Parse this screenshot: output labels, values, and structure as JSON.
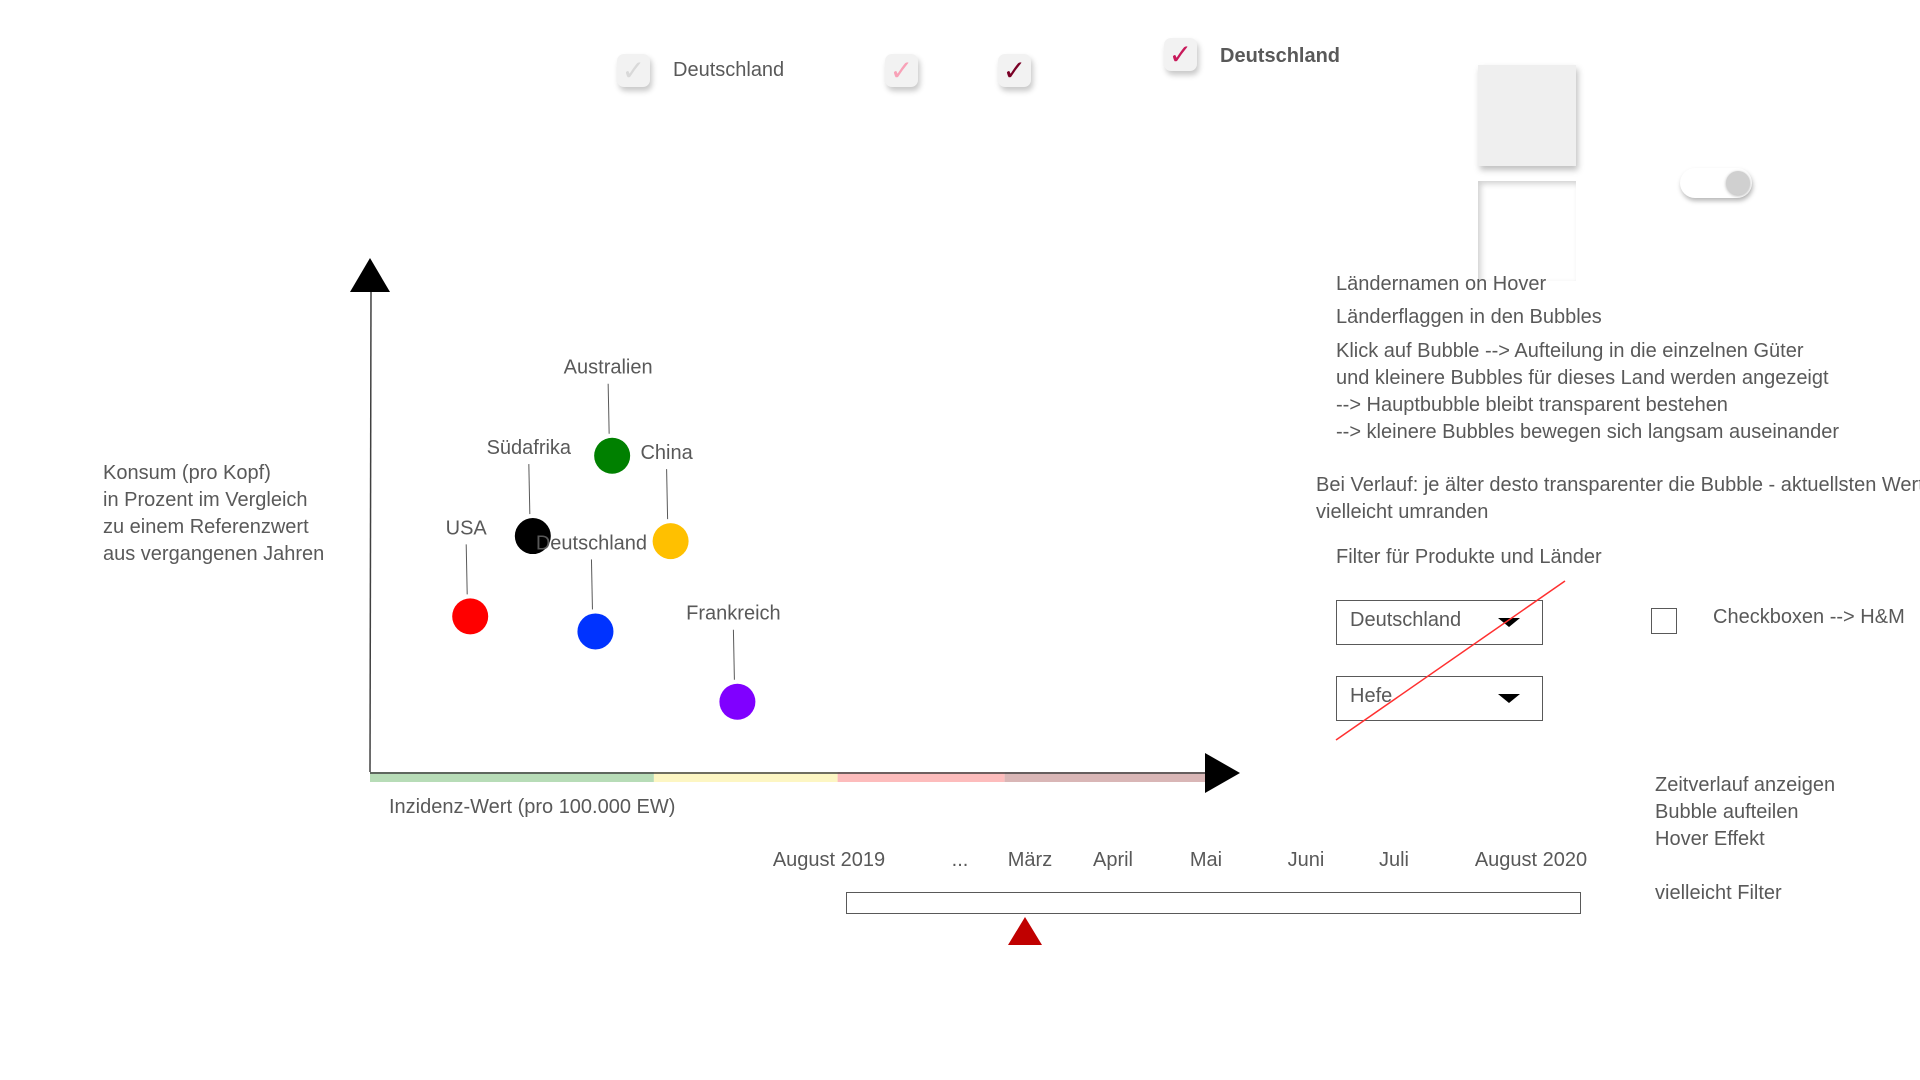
{
  "checkbox_states": {
    "items": [
      {
        "label": "Deutschland",
        "mark": "✓",
        "mark_color": "#d9d9d9",
        "state": "disabled"
      },
      {
        "label": "",
        "mark": "✓",
        "mark_color": "#f8a1b7",
        "state": "hover"
      },
      {
        "label": "",
        "mark": "✓",
        "mark_color": "#7a0026",
        "state": "pressed"
      },
      {
        "label": "Deutschland",
        "mark": "✓",
        "mark_color": "#c8195a",
        "state": "checked"
      }
    ]
  },
  "notes": {
    "hover_names": "Ländernamen on Hover",
    "flags": "Länderflaggen in den Bubbles",
    "click_lines": [
      "Klick auf Bubble --> Aufteilung in die einzelnen Güter",
      "und kleinere Bubbles für dieses Land werden angezeigt",
      "--> Hauptbubble bleibt transparent bestehen",
      "--> kleinere Bubbles bewegen sich langsam auseinander"
    ],
    "verlauf_lines": [
      "Bei Verlauf: je älter desto transparenter die Bubble - aktuellsten Wert",
      "vielleicht umranden"
    ],
    "filter_heading": "Filter für Produkte und Länder",
    "checkbox_note": "Checkboxen --> H&M",
    "todo_lines": [
      "Zeitverlauf anzeigen",
      "Bubble aufteilen",
      "Hover Effekt",
      "",
      "vielleicht Filter"
    ]
  },
  "filters": {
    "country_value": "Deutschland",
    "product_value": "Hefe",
    "strike_color": "#ff0000"
  },
  "timeline": {
    "labels": [
      "August 2019",
      "...",
      "März",
      "April",
      "Mai",
      "Juni",
      "Juli",
      "August 2020"
    ],
    "selected": "März",
    "marker_color": "#c00000"
  },
  "chart_data": {
    "type": "scatter",
    "ylabel_lines": [
      "Konsum (pro Kopf)",
      "in Prozent im Vergleich",
      "zu einem Referenzwert",
      "aus vergangenen Jahren"
    ],
    "xlabel": "Inzidenz-Wert (pro 100.000 EW)",
    "axis_bands": [
      {
        "from": 0,
        "to": 0.34,
        "color": "#b7dcb7"
      },
      {
        "from": 0.34,
        "to": 0.56,
        "color": "#fdf6c3"
      },
      {
        "from": 0.56,
        "to": 0.76,
        "color": "#fdbcbc"
      },
      {
        "from": 0.76,
        "to": 1.0,
        "color": "#d9b6b6"
      }
    ],
    "points": [
      {
        "name": "USA",
        "x": 0.12,
        "y": 0.31,
        "color": "#ff0000"
      },
      {
        "name": "Südafrika",
        "x": 0.195,
        "y": 0.47,
        "color": "#000000"
      },
      {
        "name": "Deutschland",
        "x": 0.27,
        "y": 0.28,
        "color": "#0033ff"
      },
      {
        "name": "Australien",
        "x": 0.29,
        "y": 0.63,
        "color": "#008000"
      },
      {
        "name": "China",
        "x": 0.36,
        "y": 0.46,
        "color": "#ffc000"
      },
      {
        "name": "Frankreich",
        "x": 0.44,
        "y": 0.14,
        "color": "#8000ff"
      }
    ]
  }
}
